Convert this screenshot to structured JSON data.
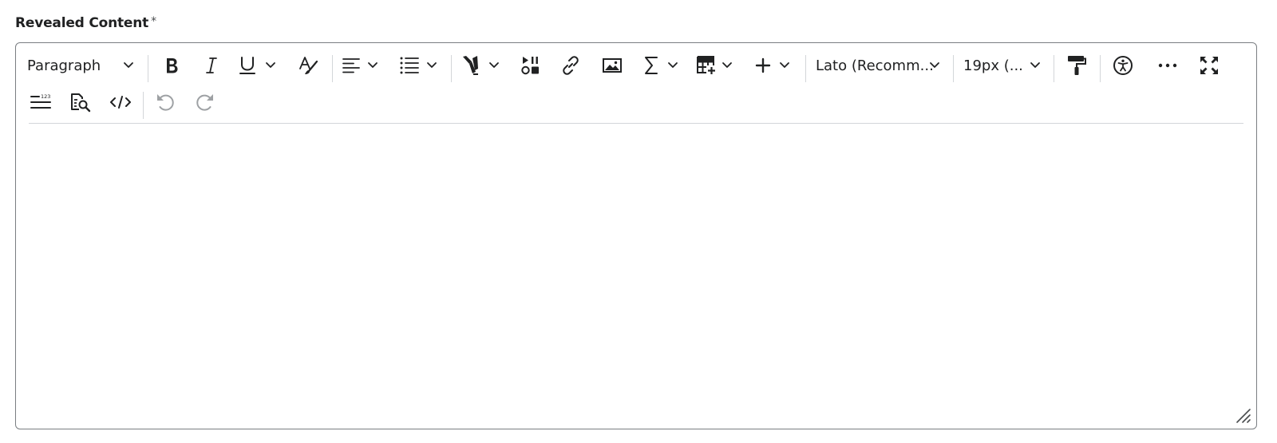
{
  "field": {
    "label": "Revealed Content",
    "required_marker": "*"
  },
  "toolbar": {
    "block_format": "Paragraph",
    "font_family": "Lato (Recomm...",
    "font_size": "19px (..."
  },
  "icons": {
    "bold": "bold-icon",
    "italic": "italic-icon",
    "underline": "underline-icon",
    "format": "text-format-icon",
    "align": "align-left-icon",
    "list": "bullet-list-icon",
    "color": "highlighter-icon",
    "media": "media-icon",
    "link": "link-icon",
    "image": "image-icon",
    "equation": "sigma-icon",
    "table": "table-icon",
    "insert": "plus-icon",
    "format_painter": "paint-roller-icon",
    "accessibility": "accessibility-icon",
    "more": "ellipsis-icon",
    "fullscreen": "fullscreen-icon",
    "line_numbers": "line-numbers-icon",
    "preview": "preview-icon",
    "source": "source-code-icon",
    "undo": "undo-icon",
    "redo": "redo-icon"
  },
  "colors": {
    "text": "#202122",
    "border": "#7a7e82",
    "separator": "#d3d6d9",
    "disabled": "#9ea1a4"
  }
}
